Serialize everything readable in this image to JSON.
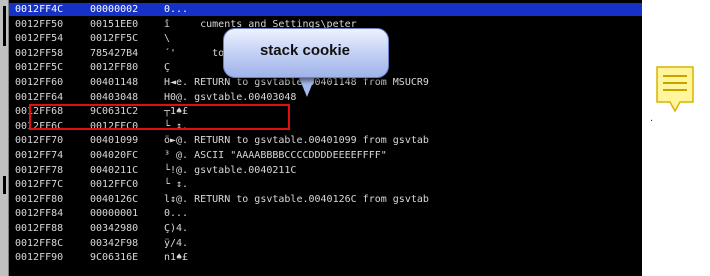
{
  "rows": [
    {
      "addr": "0012FF4C",
      "val": "00000002",
      "comment": "0..."
    },
    {
      "addr": "0012FF50",
      "val": "00151EE0",
      "comment": "î     cuments and Settings\\peter"
    },
    {
      "addr": "0012FF54",
      "val": "0012FF5C",
      "comment": "\\"
    },
    {
      "addr": "0012FF58",
      "val": "785427B4",
      "comment": "´'      to     .785427B4 from MSUCR90"
    },
    {
      "addr": "0012FF5C",
      "val": "0012FF80",
      "comment": "Ç"
    },
    {
      "addr": "0012FF60",
      "val": "00401148",
      "comment": "H◄e. RETURN to gsvtable.00401148 from MSUCR9"
    },
    {
      "addr": "0012FF64",
      "val": "00403048",
      "comment": "H0@. gsvtable.00403048"
    },
    {
      "addr": "0012FF68",
      "val": "9C0631C2",
      "comment": "┬1♠£"
    },
    {
      "addr": "0012FF6C",
      "val": "0012FFC0",
      "comment": "└ ↕."
    },
    {
      "addr": "0012FF70",
      "val": "00401099",
      "comment": "ö►@. RETURN to gsvtable.00401099 from gsvtab"
    },
    {
      "addr": "0012FF74",
      "val": "004020FC",
      "comment": "³ @. ASCII \"AAAABBBBCCCCDDDDEEEEFFFF\""
    },
    {
      "addr": "0012FF78",
      "val": "0040211C",
      "comment": "└!@. gsvtable.0040211C"
    },
    {
      "addr": "0012FF7C",
      "val": "0012FFC0",
      "comment": "└ ↕."
    },
    {
      "addr": "0012FF80",
      "val": "0040126C",
      "comment": "l↕@. RETURN to gsvtable.0040126C from gsvtab"
    },
    {
      "addr": "0012FF84",
      "val": "00000001",
      "comment": "0..."
    },
    {
      "addr": "0012FF88",
      "val": "00342980",
      "comment": "Ç)4."
    },
    {
      "addr": "0012FF8C",
      "val": "00342F98",
      "comment": "ÿ/4."
    },
    {
      "addr": "0012FF90",
      "val": "9C06316E",
      "comment": "n1♠£"
    }
  ],
  "callout": {
    "text": "stack cookie"
  },
  "trailing_mark": ".",
  "colors": {
    "background": "#000000",
    "selection": "#1531c6",
    "highlight_box": "#e01010",
    "note_icon": "#fff59a"
  }
}
